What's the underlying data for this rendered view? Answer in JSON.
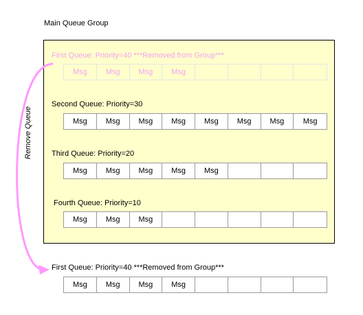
{
  "group": {
    "title": "Main Queue Group"
  },
  "queues": [
    {
      "label": "First Queue: Priority=40  ***Removed from Group***",
      "state": "removed",
      "cells": [
        "Msg",
        "Msg",
        "Msg",
        "Msg",
        "",
        "",
        "",
        ""
      ]
    },
    {
      "label": "Second Queue: Priority=30",
      "state": "active",
      "cells": [
        "Msg",
        "Msg",
        "Msg",
        "Msg",
        "Msg",
        "Msg",
        "Msg",
        "Msg"
      ]
    },
    {
      "label": "Third Queue: Priority=20",
      "state": "active",
      "cells": [
        "Msg",
        "Msg",
        "Msg",
        "Msg",
        "Msg",
        "",
        "",
        ""
      ]
    },
    {
      "label": "Fourth Queue: Priority=10",
      "state": "active",
      "cells": [
        "Msg",
        "Msg",
        "Msg",
        "",
        "",
        "",
        "",
        ""
      ]
    }
  ],
  "removed_queue": {
    "label": "First Queue: Priority=40  ***Removed from Group***",
    "cells": [
      "Msg",
      "Msg",
      "Msg",
      "Msg",
      "",
      "",
      "",
      ""
    ]
  },
  "arrow": {
    "label": "Remove Queue",
    "color": "#ff99ff"
  },
  "colors": {
    "group_fill": "#ffffcc",
    "faded_text": "#f2a3f2"
  }
}
